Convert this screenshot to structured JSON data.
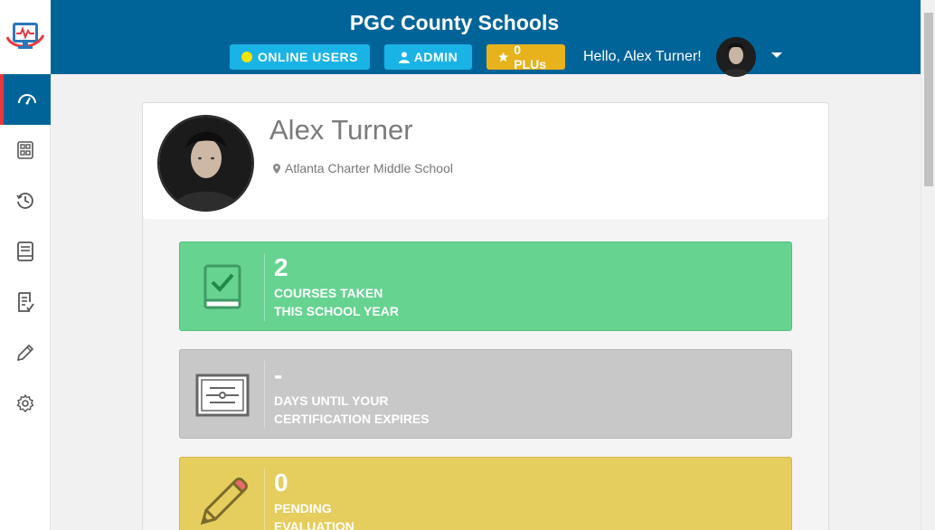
{
  "header": {
    "title": "PGC County Schools",
    "online_users_label": "ONLINE USERS",
    "admin_label": "ADMIN",
    "plu_label": "0 PLUs",
    "greeting_prefix": "Hello,",
    "greeting_name": "Alex Turner!"
  },
  "sidebar": {
    "items": [
      {
        "name": "dashboard",
        "icon": "gauge-icon",
        "active": true
      },
      {
        "name": "catalog",
        "icon": "grid-list-icon",
        "active": false
      },
      {
        "name": "history",
        "icon": "clock-history-icon",
        "active": false
      },
      {
        "name": "library",
        "icon": "book-icon",
        "active": false
      },
      {
        "name": "evaluations",
        "icon": "checklist-icon",
        "active": false
      },
      {
        "name": "edit",
        "icon": "pencil-icon",
        "active": false
      },
      {
        "name": "settings",
        "icon": "gear-icon",
        "active": false
      }
    ]
  },
  "profile": {
    "name": "Alex Turner",
    "school": "Atlanta Charter Middle School"
  },
  "stats": [
    {
      "value": "2",
      "line1": "COURSES TAKEN",
      "line2": "THIS SCHOOL YEAR",
      "icon": "book-check-icon",
      "color": "#66d391"
    },
    {
      "value": "-",
      "line1": "DAYS UNTIL YOUR",
      "line2": "CERTIFICATION EXPIRES",
      "icon": "certificate-icon",
      "color": "#c8c8c8"
    },
    {
      "value": "0",
      "line1": "PENDING",
      "line2": "EVALUATION",
      "icon": "pencil-icon",
      "color": "#e5cd5e"
    }
  ],
  "colors": {
    "primary": "#006499",
    "accent_button": "#1ab3e6",
    "plu_button": "#e8b21d",
    "active_indicator": "#e8383d"
  }
}
